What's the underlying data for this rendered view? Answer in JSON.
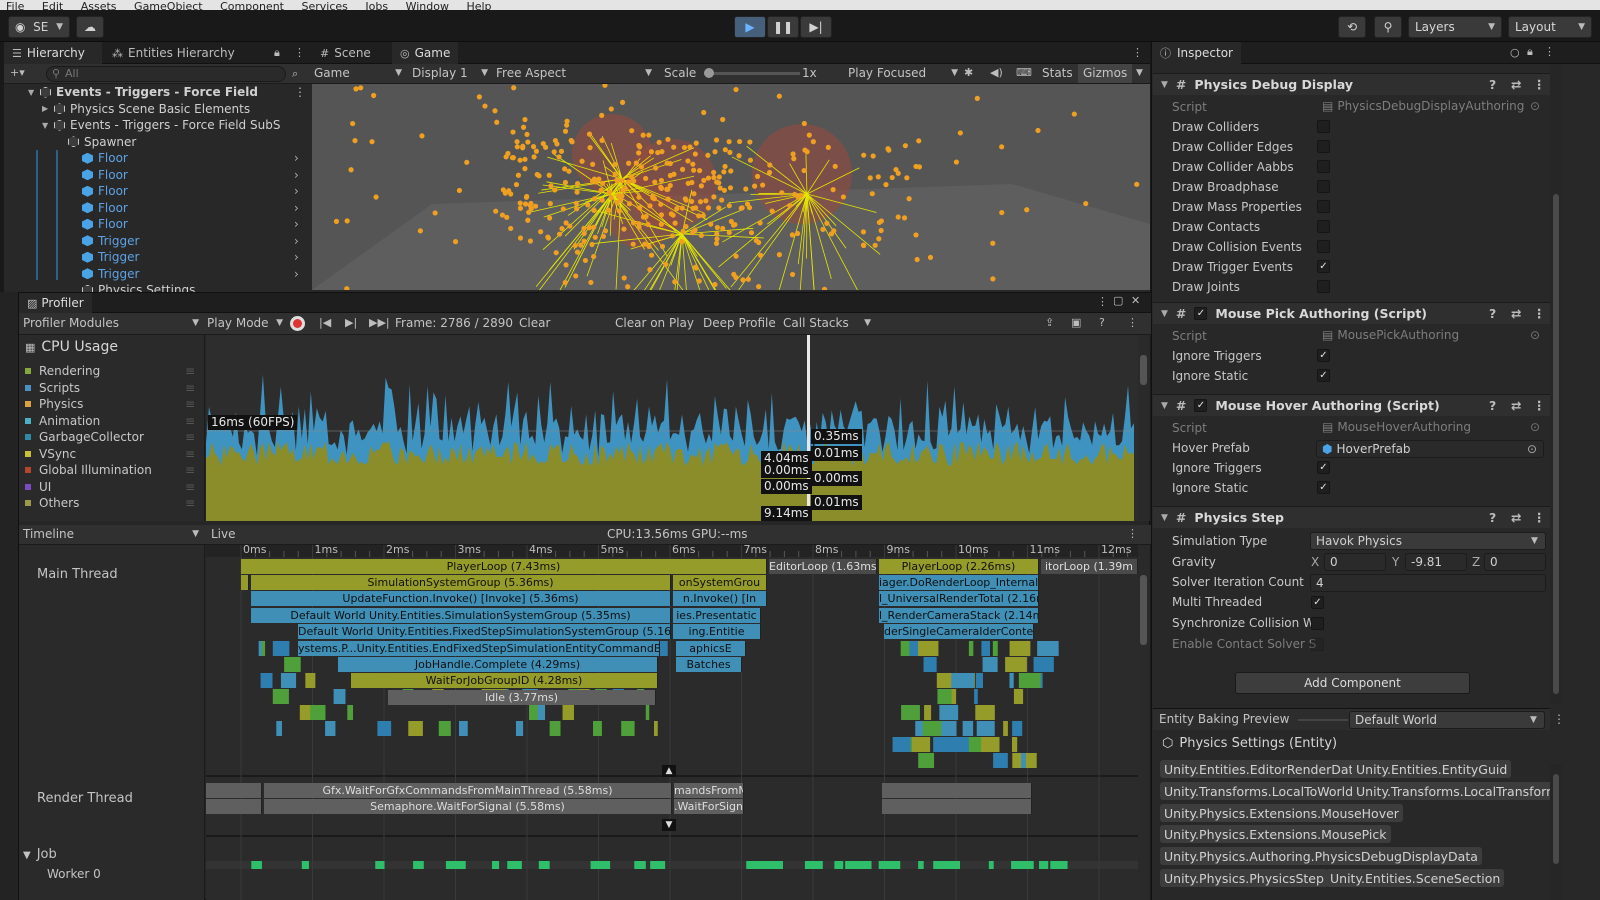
{
  "menu": [
    "File",
    "Edit",
    "Assets",
    "GameObject",
    "Component",
    "Services",
    "Jobs",
    "Window",
    "Help"
  ],
  "toolbar": {
    "account": "SE",
    "layers_label": "Layers",
    "layout_label": "Layout"
  },
  "hierarchy": {
    "tabs": [
      "Hierarchy",
      "Entities Hierarchy"
    ],
    "search_placeholder": "All",
    "rows": [
      {
        "label": "Events - Triggers - Force Field",
        "bold": true,
        "icon": "unity-scene-icon",
        "blue": false
      },
      {
        "label": "Physics Scene Basic Elements",
        "icon": "cube-icon",
        "blue": false
      },
      {
        "label": "Events - Triggers - Force Field SubS",
        "icon": "unity-scene-icon",
        "blue": false
      },
      {
        "label": "Spawner",
        "icon": "cube-icon",
        "blue": false
      },
      {
        "label": "Floor",
        "icon": "prefab-icon",
        "blue": true
      },
      {
        "label": "Floor",
        "icon": "prefab-icon",
        "blue": true
      },
      {
        "label": "Floor",
        "icon": "prefab-icon",
        "blue": true
      },
      {
        "label": "Floor",
        "icon": "prefab-icon",
        "blue": true
      },
      {
        "label": "Floor",
        "icon": "prefab-icon",
        "blue": true
      },
      {
        "label": "Trigger",
        "icon": "prefab-icon",
        "blue": true
      },
      {
        "label": "Trigger",
        "icon": "prefab-icon",
        "blue": true
      },
      {
        "label": "Trigger",
        "icon": "prefab-icon",
        "blue": true
      },
      {
        "label": "Physics Settings",
        "icon": "cube-icon",
        "blue": false
      }
    ]
  },
  "gameview": {
    "tabs": [
      "Scene",
      "Game"
    ],
    "display_mode": "Game",
    "display": "Display 1",
    "aspect": "Free Aspect",
    "scale_label": "Scale",
    "scale_value": "1x",
    "play_mode": "Play Focused",
    "stats": "Stats",
    "gizmos": "Gizmos"
  },
  "profiler": {
    "title": "Profiler",
    "modules_label": "Profiler Modules",
    "play_mode": "Play Mode",
    "frame": "Frame: 2786 / 2890",
    "clear": "Clear",
    "clear_on_play": "Clear on Play",
    "deep_profile": "Deep Profile",
    "call_stacks": "Call Stacks",
    "cpu_usage": "CPU Usage",
    "modules": [
      {
        "name": "Rendering",
        "color": "#86a93c"
      },
      {
        "name": "Scripts",
        "color": "#4a90c0"
      },
      {
        "name": "Physics",
        "color": "#dba241"
      },
      {
        "name": "Animation",
        "color": "#4bb0c2"
      },
      {
        "name": "GarbageCollector",
        "color": "#2f8aa8"
      },
      {
        "name": "VSync",
        "color": "#c9c036"
      },
      {
        "name": "Global Illumination",
        "color": "#b4452e"
      },
      {
        "name": "UI",
        "color": "#7b4cbf"
      },
      {
        "name": "Others",
        "color": "#9a9a4a"
      }
    ],
    "fps_label": "16ms (60FPS)",
    "labels_left": [
      "4.04ms",
      "0.00ms",
      "0.00ms",
      "9.14ms"
    ],
    "labels_right": [
      "0.35ms",
      "0.01ms",
      "0.00ms",
      "0.01ms"
    ],
    "timeline_label": "Timeline",
    "live": "Live",
    "cpu_gpu": "CPU:13.56ms   GPU:--ms",
    "ticks": [
      "0ms",
      "1ms",
      "2ms",
      "3ms",
      "4ms",
      "5ms",
      "6ms",
      "7ms",
      "8ms",
      "9ms",
      "10ms",
      "11ms",
      "12ms"
    ],
    "threads": [
      "Main Thread",
      "Render Thread",
      "Job",
      "Worker 0"
    ],
    "bars": {
      "playerloop": "PlayerLoop (7.43ms)",
      "editorloop": "EditorLoop (1.63ms)",
      "playerloop2": "PlayerLoop (2.26ms)",
      "editorloop2": "itorLoop (1.39m",
      "simsys": "SimulationSystemGroup (5.36ms)",
      "simsys_r": "onSystemGrou",
      "updfunc": "UpdateFunction.Invoke() [Invoke] (5.36ms)",
      "updfunc_r": "n.Invoke() [In",
      "defworld": "Default World Unity.Entities.SimulationSystemGroup (5.35ms)",
      "defworld_r": "ies.Presentatic",
      "fixedstep": "Default World Unity.Entities.FixedStepSimulationSystemGroup (5.16ms)",
      "fixedstep_r": "ing.Entitie",
      "endfixed": "ystems.P...Unity.Entities.EndFixedStepSimulationEntityCommandBufferSy",
      "endfixed_r": "aphicsE",
      "jobcomplete": "JobHandle.Complete (4.29ms)",
      "jobcomplete_r": "Batches",
      "waitjob": "WaitForJobGroupID (4.28ms)",
      "idle": "Idle (3.77ms)",
      "mgr": "iager.DoRenderLoop_Internal()",
      "urp": "l_UniversalRenderTotal (2.16m",
      "camstack": "l_RenderCameraStack (2.14ms",
      "singlecam": "derSingleCameraIderContext.",
      "gfxwait": "Gfx.WaitForGfxCommandsFromMainThread (5.58ms)",
      "gfxwait_r": "mandsFromM",
      "semaphore": "Semaphore.WaitForSignal (5.58ms)",
      "semaphore_r": ".WaitForSigna"
    }
  },
  "inspector": {
    "title": "Inspector",
    "physics_debug": {
      "title": "Physics Debug Display",
      "script_label": "Script",
      "script_value": "PhysicsDebugDisplayAuthoring",
      "rows": [
        {
          "label": "Draw Colliders",
          "checked": false
        },
        {
          "label": "Draw Collider Edges",
          "checked": false
        },
        {
          "label": "Draw Collider Aabbs",
          "checked": false
        },
        {
          "label": "Draw Broadphase",
          "checked": false
        },
        {
          "label": "Draw Mass Properties",
          "checked": false
        },
        {
          "label": "Draw Contacts",
          "checked": false
        },
        {
          "label": "Draw Collision Events",
          "checked": false
        },
        {
          "label": "Draw Trigger Events",
          "checked": true
        },
        {
          "label": "Draw Joints",
          "checked": false
        }
      ]
    },
    "mouse_pick": {
      "title": "Mouse Pick Authoring (Script)",
      "script_label": "Script",
      "script_value": "MousePickAuthoring",
      "rows": [
        {
          "label": "Ignore Triggers",
          "checked": true
        },
        {
          "label": "Ignore Static",
          "checked": true
        }
      ]
    },
    "mouse_hover": {
      "title": "Mouse Hover Authoring (Script)",
      "script_label": "Script",
      "script_value": "MouseHoverAuthoring",
      "hover_label": "Hover Prefab",
      "hover_value": "HoverPrefab",
      "rows": [
        {
          "label": "Ignore Triggers",
          "checked": true
        },
        {
          "label": "Ignore Static",
          "checked": true
        }
      ]
    },
    "physics_step": {
      "title": "Physics Step",
      "sim_label": "Simulation Type",
      "sim_value": "Havok Physics",
      "gravity_label": "Gravity",
      "gx": "0",
      "gy": "-9.81",
      "gz": "0",
      "solver_label": "Solver Iteration Count",
      "solver_value": "4",
      "multi_label": "Multi Threaded",
      "multi_checked": true,
      "sync_label": "Synchronize Collision W",
      "enable_label": "Enable Contact Solver S"
    },
    "add_component": "Add Component",
    "baking_label": "Entity Baking Preview",
    "baking_world": "Default World",
    "entity_title": "Physics Settings (Entity)",
    "chips": [
      "Unity.Entities.EditorRenderData",
      "Unity.Entities.EntityGuid",
      "Unity.Transforms.LocalToWorld",
      "Unity.Transforms.LocalTransform",
      "Unity.Physics.Extensions.MouseHover",
      "Unity.Physics.Extensions.MousePick",
      "Unity.Physics.Authoring.PhysicsDebugDisplayData",
      "Unity.Physics.PhysicsStep",
      "Unity.Entities.SceneSection"
    ]
  }
}
